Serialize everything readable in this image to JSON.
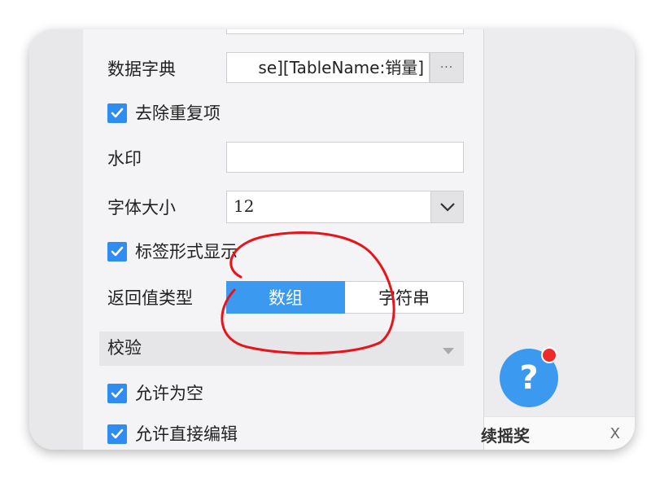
{
  "panel": {
    "data_dict": {
      "label": "数据字典",
      "value": "se][TableName:销量]",
      "more_button": "···"
    },
    "remove_dup": {
      "label": "去除重复项",
      "checked": true
    },
    "watermark": {
      "label": "水印",
      "value": ""
    },
    "font_size": {
      "label": "字体大小",
      "value": "12"
    },
    "tag_display": {
      "label": "标签形式显示",
      "checked": true
    },
    "return_type": {
      "label": "返回值类型",
      "options": [
        "数组",
        "字符串"
      ],
      "selected": "数组"
    },
    "validation": {
      "label": "校验"
    },
    "allow_empty": {
      "label": "允许为空",
      "checked": true
    },
    "allow_edit": {
      "label": "允许直接编辑",
      "checked": true
    }
  },
  "help": {
    "icon": "question-icon",
    "symbol": "?"
  },
  "banner": {
    "text": "续摇奖",
    "close": "X"
  },
  "colors": {
    "accent": "#3b9af0",
    "annotation": "#e8141b",
    "badge": "#ee2a2a"
  }
}
